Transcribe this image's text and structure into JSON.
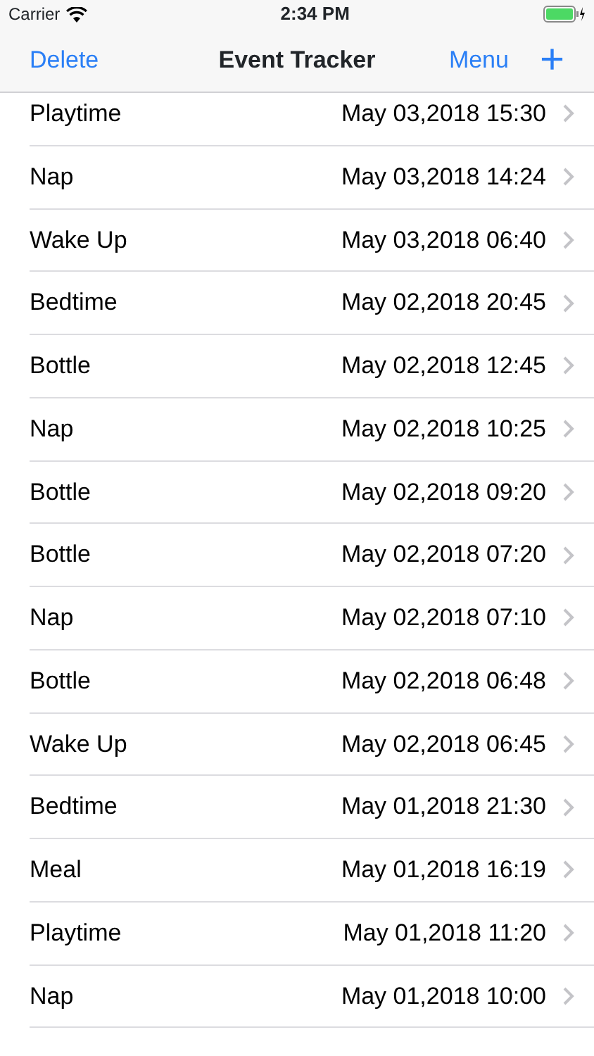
{
  "status_bar": {
    "carrier": "Carrier",
    "time": "2:34 PM"
  },
  "nav_bar": {
    "left_button": "Delete",
    "title": "Event Tracker",
    "right_button": "Menu",
    "add_button": "+"
  },
  "events": [
    {
      "name": "Playtime",
      "date": "May 03,2018 15:30"
    },
    {
      "name": "Nap",
      "date": "May 03,2018 14:24"
    },
    {
      "name": "Wake Up",
      "date": "May 03,2018 06:40"
    },
    {
      "name": "Bedtime",
      "date": "May 02,2018 20:45"
    },
    {
      "name": "Bottle",
      "date": "May 02,2018 12:45"
    },
    {
      "name": "Nap",
      "date": "May 02,2018 10:25"
    },
    {
      "name": "Bottle",
      "date": "May 02,2018 09:20"
    },
    {
      "name": "Bottle",
      "date": "May 02,2018 07:20"
    },
    {
      "name": "Nap",
      "date": "May 02,2018 07:10"
    },
    {
      "name": "Bottle",
      "date": "May 02,2018 06:48"
    },
    {
      "name": "Wake Up",
      "date": "May 02,2018 06:45"
    },
    {
      "name": "Bedtime",
      "date": "May 01,2018 21:30"
    },
    {
      "name": "Meal",
      "date": "May 01,2018 16:19"
    },
    {
      "name": "Playtime",
      "date": "May 01,2018 11:20"
    },
    {
      "name": "Nap",
      "date": "May 01,2018 10:00"
    }
  ]
}
